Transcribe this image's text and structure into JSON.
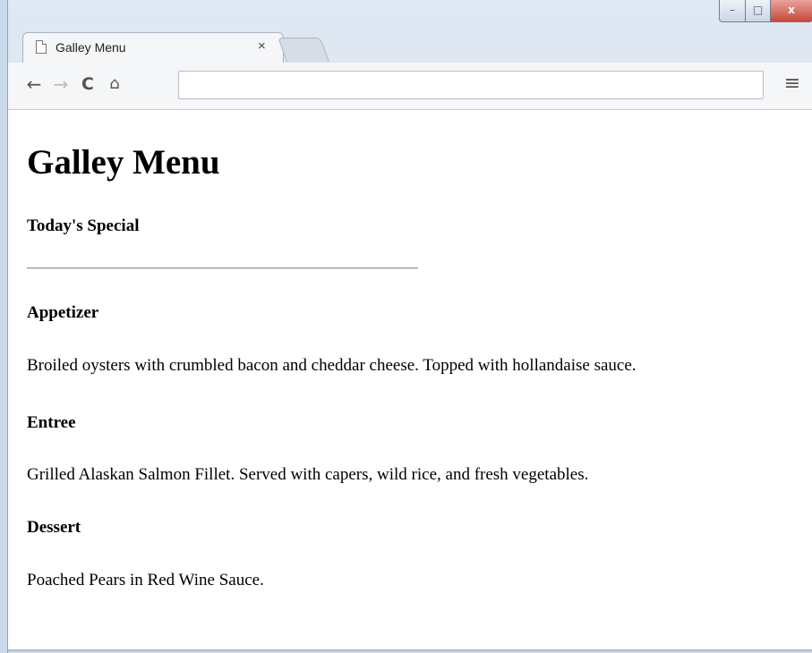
{
  "browser": {
    "tab": {
      "title": "Galley Menu",
      "close_glyph": "×"
    },
    "window_controls": {
      "minimize": "–",
      "maximize": "□",
      "close": "x"
    },
    "nav": {
      "back": "←",
      "forward": "→",
      "reload": "C",
      "home": "⌂"
    },
    "address": {
      "value": "",
      "placeholder": ""
    },
    "menu_glyph": "≡"
  },
  "page": {
    "title": "Galley Menu",
    "subtitle": "Today's Special",
    "sections": [
      {
        "heading": "Appetizer",
        "text": "Broiled oysters with crumbled bacon and cheddar cheese. Topped with hollandaise sauce."
      },
      {
        "heading": "Entree",
        "text": "Grilled Alaskan Salmon Fillet. Served with capers, wild rice, and fresh vegetables."
      },
      {
        "heading": "Dessert",
        "text": "Poached Pears in Red Wine Sauce."
      }
    ]
  }
}
